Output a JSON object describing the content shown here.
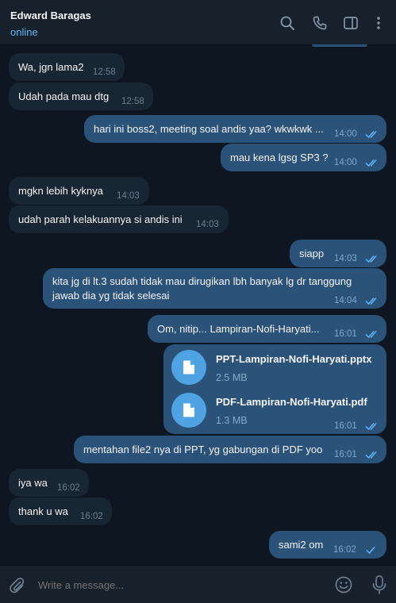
{
  "header": {
    "contact_name": "Edward Baragas",
    "status": "online",
    "icons": [
      "search-icon",
      "phone-icon",
      "sidebar-toggle-icon",
      "more-vertical-icon"
    ]
  },
  "messages": [
    {
      "dir": "in",
      "text": "Wa, jgn lama2",
      "time": "12:58"
    },
    {
      "dir": "in",
      "text": "Udah pada mau dtg",
      "time": "12:58"
    },
    {
      "dir": "out",
      "text": "hari ini boss2, meeting soal andis yaa? wkwkwk ...",
      "time": "14:00",
      "read": true
    },
    {
      "dir": "out",
      "text": "mau kena lgsg SP3 ?",
      "time": "14:00",
      "read": true
    },
    {
      "dir": "in",
      "text": "mgkn lebih kyknya",
      "time": "14:03"
    },
    {
      "dir": "in",
      "text": "udah parah kelakuannya si andis ini",
      "time": "14:03"
    },
    {
      "dir": "out",
      "text": "siapp",
      "time": "14:03",
      "read": true
    },
    {
      "dir": "out",
      "text_line1": "kita jg di lt.3 sudah tidak mau dirugikan lbh banyak lg dr tanggung",
      "text_line2": "jawab dia yg tidak selesai",
      "time": "14:04",
      "read": true
    },
    {
      "dir": "out",
      "text": "Om, nitip... Lampiran-Nofi-Haryati...",
      "time": "16:01",
      "read": true
    },
    {
      "dir": "out",
      "files": [
        {
          "name": "PPT-Lampiran-Nofi-Haryati.pptx",
          "size": "2.5 MB"
        },
        {
          "name": "PDF-Lampiran-Nofi-Haryati.pdf",
          "size": "1.3 MB"
        }
      ],
      "time": "16:01",
      "read": true
    },
    {
      "dir": "out",
      "text": "mentahan file2 nya di PPT, yg gabungan di PDF yoo",
      "time": "16:01",
      "read": true
    },
    {
      "dir": "in",
      "text": "iya wa",
      "time": "16:02"
    },
    {
      "dir": "in",
      "text": "thank u wa",
      "time": "16:02"
    },
    {
      "dir": "out",
      "text": "sami2 om",
      "time": "16:02",
      "read": false
    }
  ],
  "composer": {
    "placeholder": "Write a message...",
    "icons": [
      "paperclip-icon",
      "emoji-icon",
      "microphone-icon"
    ]
  },
  "colors": {
    "background": "#0e1621",
    "header": "#17212b",
    "incoming_bubble": "#182533",
    "outgoing_bubble": "#2b5278",
    "accent": "#5eb5f7",
    "file_icon": "#4fa3e3"
  }
}
